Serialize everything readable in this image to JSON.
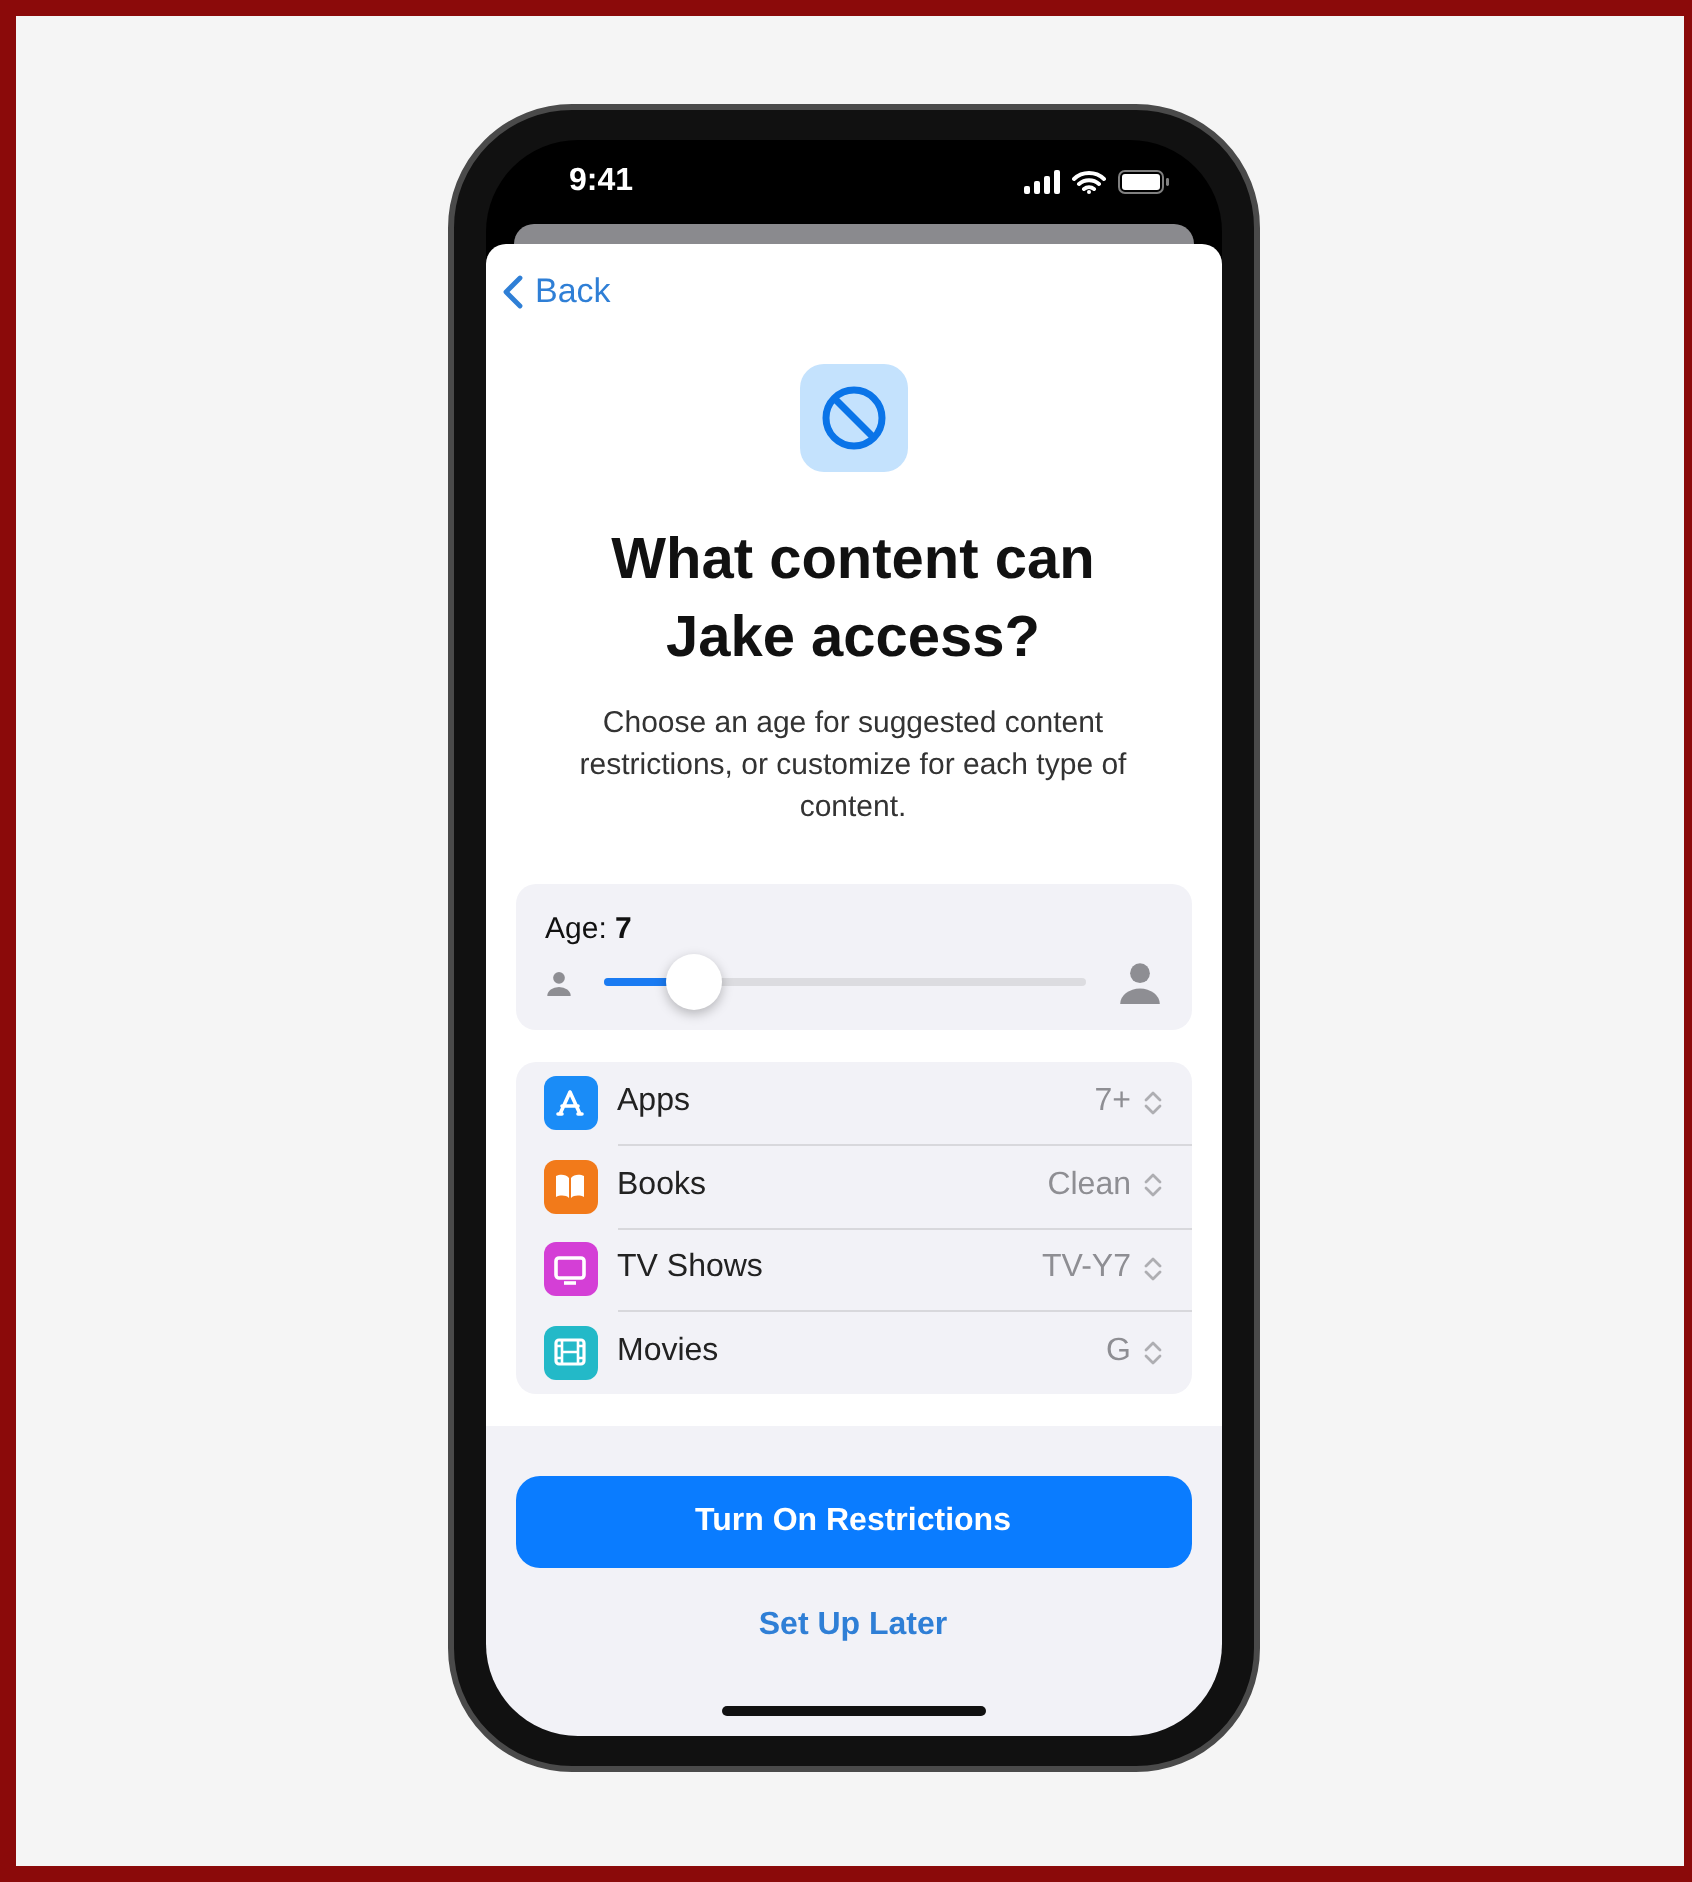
{
  "status_bar": {
    "time": "9:41"
  },
  "nav": {
    "back": "Back"
  },
  "heading": {
    "title": "What content can Jake access?",
    "description": "Choose an age for suggested content restrictions, or customize for each type of content."
  },
  "age": {
    "label": "Age: **7**",
    "level": 0.15
  },
  "categories": [
    {
      "kind": "apps",
      "name": "Apps",
      "value": "7+"
    },
    {
      "kind": "books",
      "name": "Books",
      "value": "Clean"
    },
    {
      "kind": "tv",
      "name": "TV Shows",
      "value": "TV-Y7"
    },
    {
      "kind": "movies",
      "name": "Movies",
      "value": "G"
    }
  ],
  "buttons": {
    "primary": "Turn On Restrictions",
    "secondary": "Set Up Later"
  }
}
